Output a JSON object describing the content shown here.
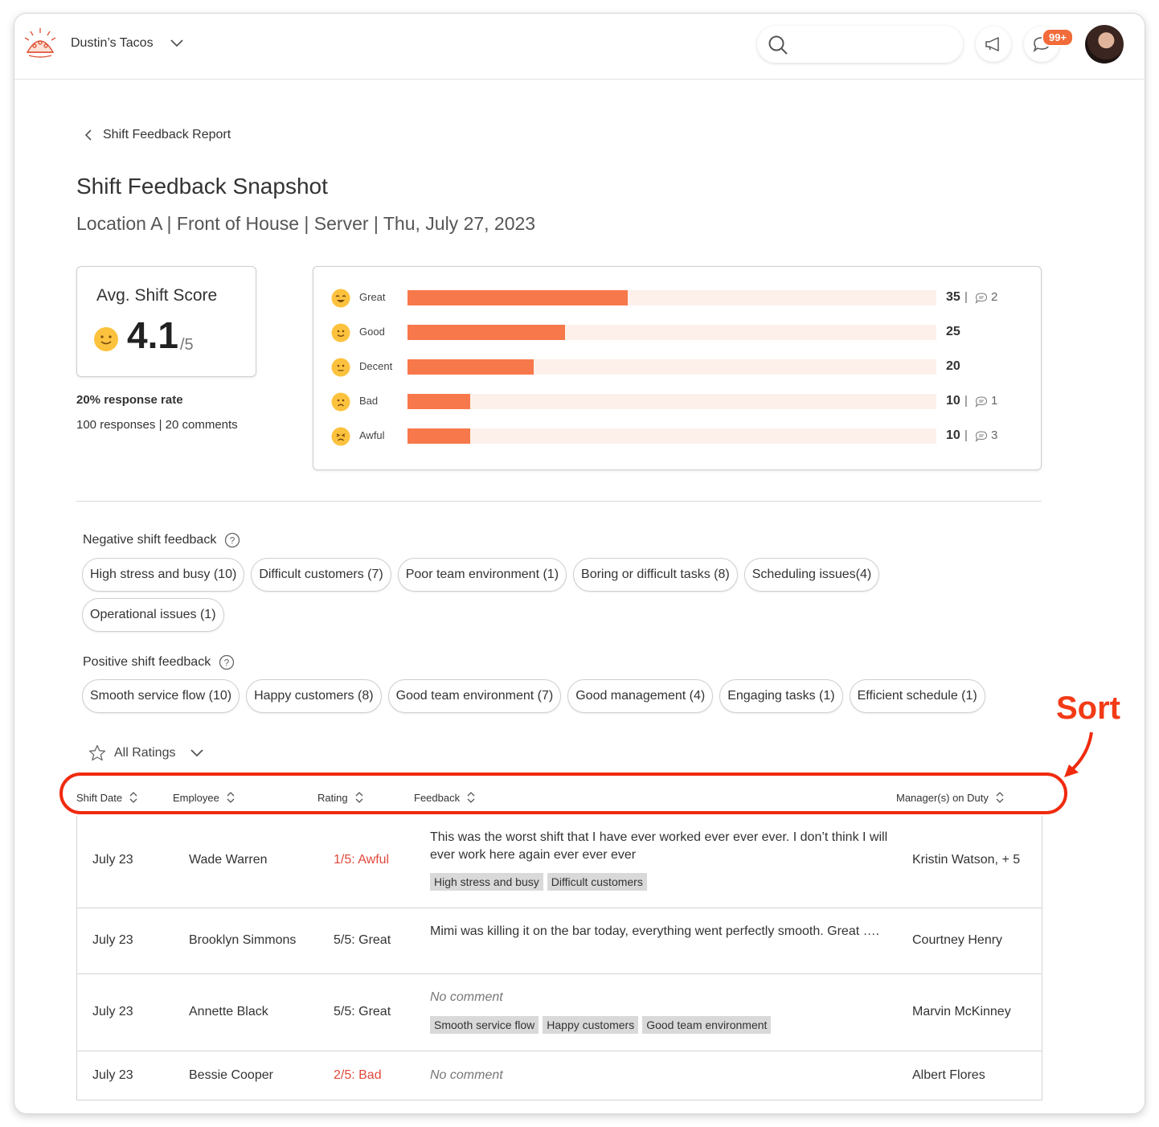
{
  "header": {
    "company": "Dustin’s Tacos",
    "notification_count": "99+"
  },
  "breadcrumb": {
    "back_label": "Shift Feedback Report"
  },
  "page": {
    "title": "Shift Feedback Snapshot",
    "subtitle": "Location A | Front of House | Server | Thu, July 27, 2023"
  },
  "score": {
    "label": "Avg. Shift Score",
    "value": "4.1",
    "max": "/5",
    "response_rate": "20% response rate",
    "responses": "100 responses | 20 comments"
  },
  "chart_data": {
    "type": "bar",
    "categories": [
      "Great",
      "Good",
      "Decent",
      "Bad",
      "Awful"
    ],
    "values": [
      35,
      25,
      20,
      10,
      10
    ],
    "comments": [
      2,
      null,
      null,
      1,
      3
    ],
    "xlim": [
      0,
      84
    ],
    "colors": {
      "fill": "#f7784a",
      "track": "#fdf0eb"
    }
  },
  "negative": {
    "heading": "Negative shift feedback",
    "chips": [
      "High stress and busy (10)",
      "Difficult customers (7)",
      "Poor team environment (1)",
      "Boring or difficult tasks (8)",
      "Scheduling issues(4)",
      "Operational issues (1)"
    ]
  },
  "positive": {
    "heading": "Positive shift feedback",
    "chips": [
      "Smooth service flow (10)",
      "Happy customers (8)",
      "Good team environment (7)",
      "Good management (4)",
      "Engaging tasks (1)",
      "Efficient schedule (1)"
    ]
  },
  "annotation": {
    "sort_label": "Sort",
    "color": "#f02a0e"
  },
  "filter": {
    "label": "All Ratings"
  },
  "table": {
    "columns": [
      "Shift Date",
      "Employee",
      "Rating",
      "Feedback",
      "Manager(s) on Duty"
    ],
    "rows": [
      {
        "date": "July 23",
        "employee": "Wade Warren",
        "rating": "1/5: Awful",
        "feedback": "This was the worst shift that I have ever worked ever ever ever. I don’t think I will ever work here again ever ever ever",
        "tags": [
          "High stress and busy",
          "Difficult customers"
        ],
        "manager": "Kristin Watson, + 5"
      },
      {
        "date": "July 23",
        "employee": "Brooklyn Simmons",
        "rating": "5/5: Great",
        "feedback": "Mimi was killing it on the bar today, everything went perfectly smooth. Great ….",
        "tags": [],
        "manager": "Courtney Henry"
      },
      {
        "date": "July 23",
        "employee": "Annette Black",
        "rating": "5/5: Great",
        "feedback": "No comment",
        "tags": [
          "Smooth service flow",
          "Happy customers",
          "Good team environment"
        ],
        "manager": "Marvin McKinney"
      },
      {
        "date": "July 23",
        "employee": "Bessie Cooper",
        "rating": "2/5: Bad",
        "feedback": "No comment",
        "tags": [],
        "manager": "Albert Flores"
      }
    ]
  }
}
